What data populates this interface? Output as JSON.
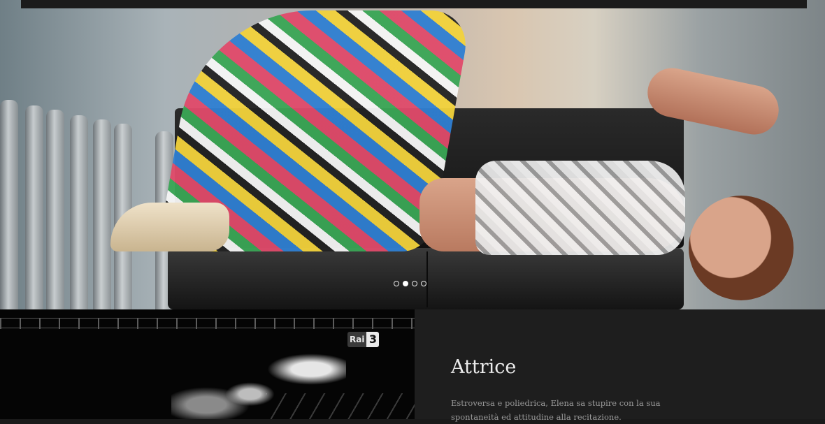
{
  "hero": {
    "slider": {
      "dots": [
        {
          "active": false
        },
        {
          "active": true
        },
        {
          "active": false
        },
        {
          "active": false
        }
      ]
    }
  },
  "feature": {
    "video_logo": {
      "text": "Rai",
      "number": "3"
    },
    "title": "Attrice",
    "description": "Estroversa e poliedrica, Elena sa stupire con la sua spontaneità ed attitudine alla recitazione."
  }
}
